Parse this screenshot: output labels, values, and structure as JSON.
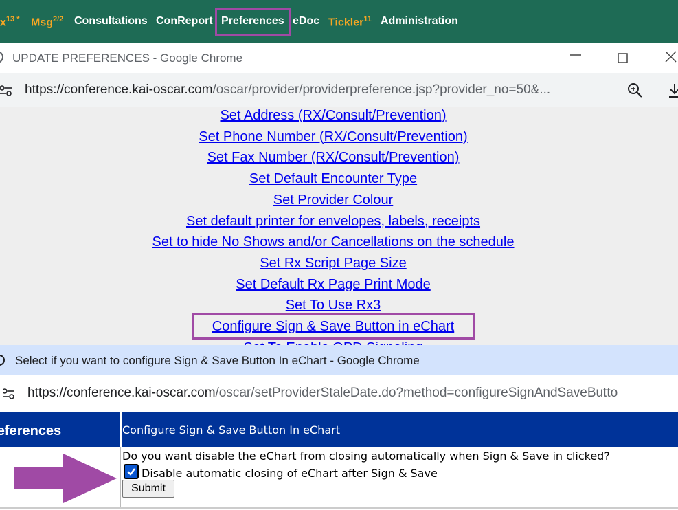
{
  "topnav": {
    "items": [
      {
        "label": "x",
        "sup": "13 *",
        "color": "orange"
      },
      {
        "label": "Msg",
        "sup": "2/2",
        "color": "orange"
      },
      {
        "label": "Consultations",
        "sup": "",
        "color": "white"
      },
      {
        "label": "ConReport",
        "sup": "",
        "color": "white"
      },
      {
        "label": "Preferences",
        "sup": "",
        "color": "white"
      },
      {
        "label": "eDoc",
        "sup": "",
        "color": "white"
      },
      {
        "label": "Tickler",
        "sup": "11",
        "color": "orange"
      },
      {
        "label": "Administration",
        "sup": "",
        "color": "white"
      }
    ]
  },
  "window1": {
    "title": "UPDATE PREFERENCES - Google Chrome",
    "url_domain": "https://conference.kai-oscar.com",
    "url_path": "/oscar/provider/providerpreference.jsp?provider_no=50&...",
    "links": [
      "Set Address (RX/Consult/Prevention)",
      "Set Phone Number (RX/Consult/Prevention)",
      "Set Fax Number (RX/Consult/Prevention)",
      "Set Default Encounter Type",
      "Set Provider Colour",
      "Set default printer for envelopes, labels, receipts",
      "Set to hide No Shows and/or Cancellations on the schedule",
      "Set Rx Script Page Size",
      "Set Default Rx Page Print Mode",
      "Set To Use Rx3",
      "Configure Sign & Save Button in eChart",
      "Set To Enable OPD Signaling"
    ]
  },
  "window2": {
    "title": "Select if you want to configure Sign & Save Button In eChart - Google Chrome",
    "url_domain": "https://conference.kai-oscar.com",
    "url_path": "/oscar/setProviderStaleDate.do?method=configureSignAndSaveButto",
    "side_header": "references",
    "main_header": "Configure Sign & Save Button In eChart",
    "question": "Do you want disable the eChart from closing automatically when Sign & Save in clicked?",
    "checkbox_label": "Disable automatic closing of eChart after Sign & Save",
    "checkbox_checked": true,
    "submit_label": "Submit"
  },
  "colors": {
    "nav_bg": "#1e6b55",
    "highlight": "#a04aa5",
    "header_blue": "#003399",
    "link": "#0000ee"
  }
}
